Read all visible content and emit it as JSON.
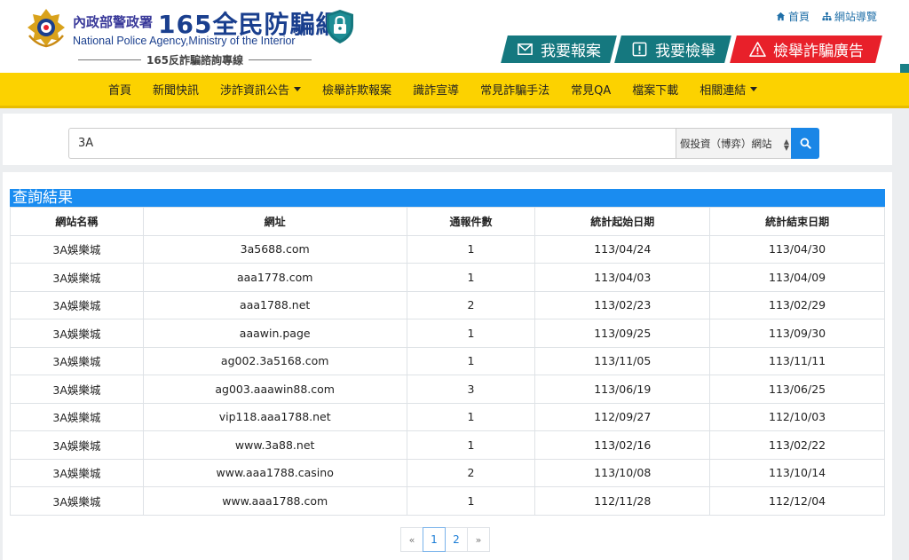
{
  "header": {
    "agency_zh": "內政部警政署",
    "brand": "165全民防騙網",
    "agency_en": "National Police Agency,Ministry of the Interior",
    "hotline": "165反詐騙諮詢專線",
    "top_links": [
      {
        "label": "首頁",
        "icon": "home-icon"
      },
      {
        "label": "網站導覽",
        "icon": "sitemap-icon"
      }
    ],
    "actions": {
      "report": "我要報案",
      "tipoff": "我要檢舉",
      "ad": "檢舉詐騙廣告"
    },
    "colors": {
      "teal": "#15787f",
      "red": "#e8202a",
      "navy": "#1a3f8e"
    }
  },
  "nav": {
    "items": [
      {
        "label": "首頁"
      },
      {
        "label": "新聞快訊"
      },
      {
        "label": "涉詐資訊公告"
      },
      {
        "label": "檢舉詐欺報案"
      },
      {
        "label": "識詐宣導"
      },
      {
        "label": "常見詐騙手法"
      },
      {
        "label": "常見QA"
      },
      {
        "label": "檔案下載"
      },
      {
        "label": "相關連結"
      }
    ],
    "color": "#fcd200"
  },
  "search": {
    "value": "3A",
    "category": "假投資（博弈）網站",
    "button_icon": "search-icon",
    "accent": "#1a86e6"
  },
  "results": {
    "title": "查詢結果",
    "columns": [
      "網站名稱",
      "網址",
      "通報件數",
      "統計起始日期",
      "統計結束日期"
    ],
    "rows": [
      [
        "3A娛樂城",
        "3a5688.com",
        "1",
        "113/04/24",
        "113/04/30"
      ],
      [
        "3A娛樂城",
        "aaa1778.com",
        "1",
        "113/04/03",
        "113/04/09"
      ],
      [
        "3A娛樂城",
        "aaa1788.net",
        "2",
        "113/02/23",
        "113/02/29"
      ],
      [
        "3A娛樂城",
        "aaawin.page",
        "1",
        "113/09/25",
        "113/09/30"
      ],
      [
        "3A娛樂城",
        "ag002.3a5168.com",
        "1",
        "113/11/05",
        "113/11/11"
      ],
      [
        "3A娛樂城",
        "ag003.aaawin88.com",
        "3",
        "113/06/19",
        "113/06/25"
      ],
      [
        "3A娛樂城",
        "vip118.aaa1788.net",
        "1",
        "112/09/27",
        "112/10/03"
      ],
      [
        "3A娛樂城",
        "www.3a88.net",
        "1",
        "113/02/16",
        "113/02/22"
      ],
      [
        "3A娛樂城",
        "www.aaa1788.casino",
        "2",
        "113/10/08",
        "113/10/14"
      ],
      [
        "3A娛樂城",
        "www.aaa1788.com",
        "1",
        "112/11/28",
        "112/12/04"
      ]
    ]
  },
  "pagination": {
    "prev": "«",
    "pages": [
      "1",
      "2"
    ],
    "current": "1",
    "next": "»"
  }
}
